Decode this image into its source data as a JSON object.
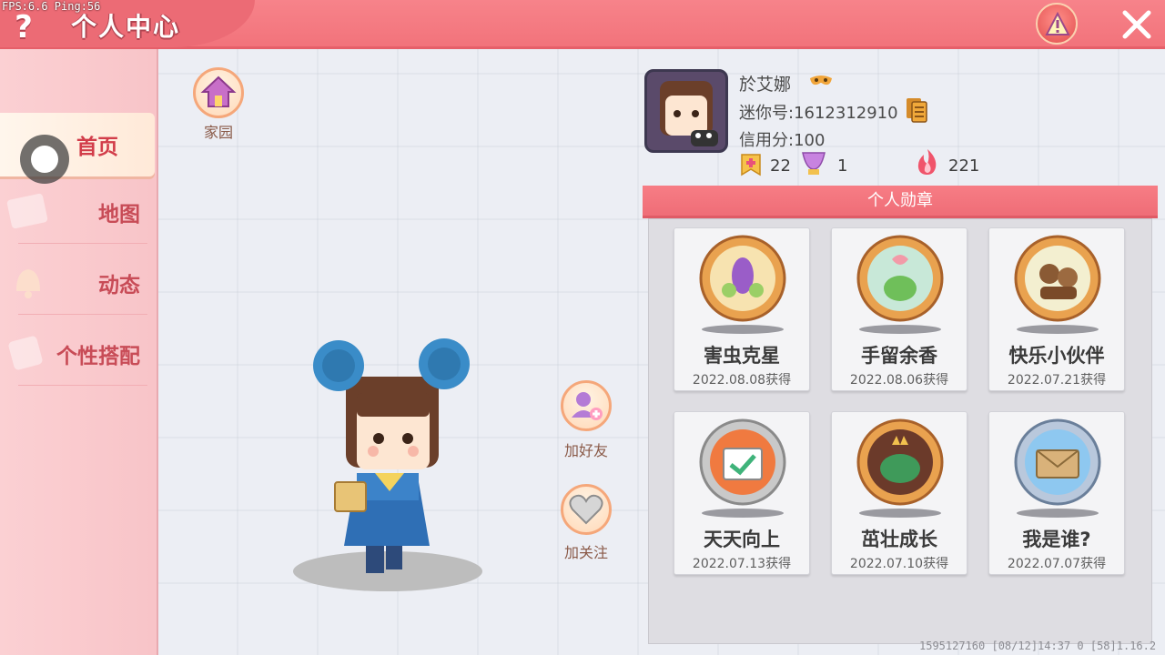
{
  "debug": {
    "fps": "FPS:6.6  Ping:56"
  },
  "header": {
    "title": "个人中心"
  },
  "sidebar": {
    "items": [
      {
        "label": "首页",
        "active": true
      },
      {
        "label": "地图",
        "active": false
      },
      {
        "label": "动态",
        "active": false
      },
      {
        "label": "个性搭配",
        "active": false
      }
    ]
  },
  "actions": {
    "home_label": "家园",
    "add_friend_label": "加好友",
    "follow_label": "加关注"
  },
  "profile": {
    "name": "於艾娜",
    "mini_id": "迷你号:1612312910",
    "credit": "信用分:100",
    "stats": {
      "badges": "22",
      "trophies": "1",
      "popularity": "221"
    }
  },
  "medals": {
    "section_title": "个人勋章",
    "items": [
      {
        "name": "害虫克星",
        "date": "2022.08.08获得"
      },
      {
        "name": "手留余香",
        "date": "2022.08.06获得"
      },
      {
        "name": "快乐小伙伴",
        "date": "2022.07.21获得"
      },
      {
        "name": "天天向上",
        "date": "2022.07.13获得"
      },
      {
        "name": "茁壮成长",
        "date": "2022.07.10获得"
      },
      {
        "name": "我是谁?",
        "date": "2022.07.07获得"
      }
    ]
  },
  "footer": {
    "info": "1595127160  [08/12]14:37 0  [58]1.16.2"
  },
  "colors": {
    "accent": "#f2737b",
    "sidebar_bg": "#fbd0d3",
    "medal_gold": "#e9a24f"
  }
}
